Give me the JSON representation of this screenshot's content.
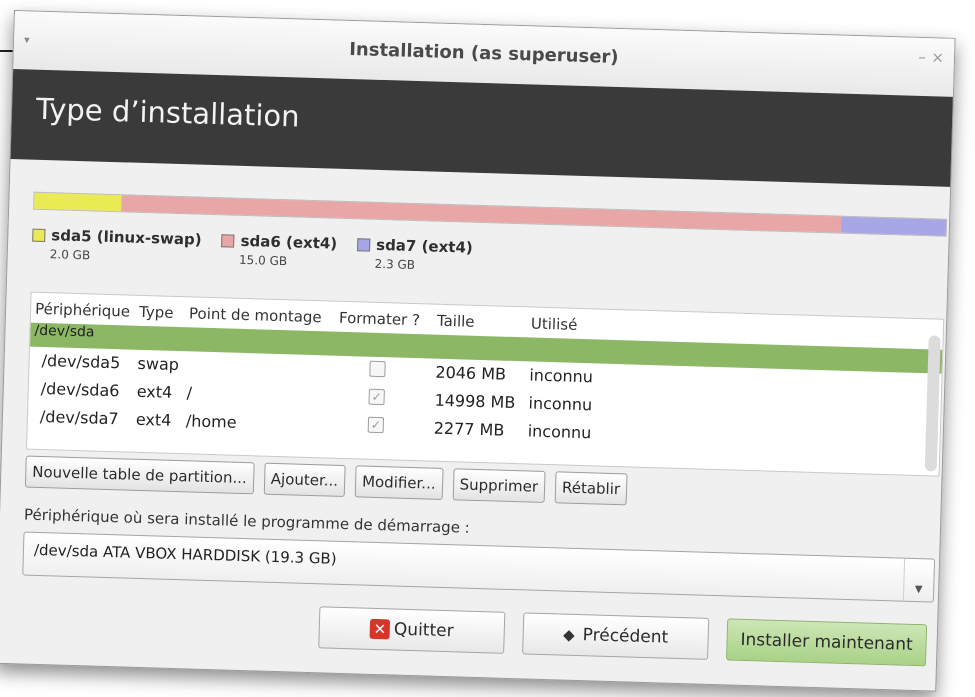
{
  "window": {
    "title": "Installation (as superuser)",
    "menu_glyph": "▾",
    "min_glyph": "–",
    "close_glyph": "×"
  },
  "header": {
    "title": "Type d’installation"
  },
  "usage": {
    "segments": [
      {
        "name": "sda5 (linux-swap)",
        "size": "2.0 GB",
        "color": "#eaea55",
        "fraction": 0.095
      },
      {
        "name": "sda6 (ext4)",
        "size": "15.0 GB",
        "color": "#e8a6a6",
        "fraction": 0.79
      },
      {
        "name": "sda7 (ext4)",
        "size": "2.3 GB",
        "color": "#a7a7e6",
        "fraction": 0.115
      }
    ]
  },
  "table": {
    "headers": [
      "Périphérique",
      "Type",
      "Point de montage",
      "Formater ?",
      "Taille",
      "Utilisé"
    ],
    "disk_row": "/dev/sda",
    "rows": [
      {
        "device": "/dev/sda5",
        "type": "swap",
        "mount": "",
        "format_checked": false,
        "size": "2046 MB",
        "used": "inconnu"
      },
      {
        "device": "/dev/sda6",
        "type": "ext4",
        "mount": "/",
        "format_checked": true,
        "size": "14998 MB",
        "used": "inconnu"
      },
      {
        "device": "/dev/sda7",
        "type": "ext4",
        "mount": "/home",
        "format_checked": true,
        "size": "2277 MB",
        "used": "inconnu"
      }
    ],
    "check_glyph": "✓"
  },
  "buttons": {
    "new_table": "Nouvelle table de partition...",
    "add": "Ajouter...",
    "modify": "Modifier...",
    "delete": "Supprimer",
    "revert": "Rétablir"
  },
  "boot": {
    "label": "Périphérique où sera installé le programme de démarrage :",
    "value": "/dev/sda   ATA VBOX HARDDISK (19.3 GB)",
    "arrow": "▼"
  },
  "actions": {
    "quit": "Quitter",
    "quit_icon": "✕",
    "back": "Précédent",
    "back_icon": "◆",
    "install": "Installer maintenant"
  }
}
